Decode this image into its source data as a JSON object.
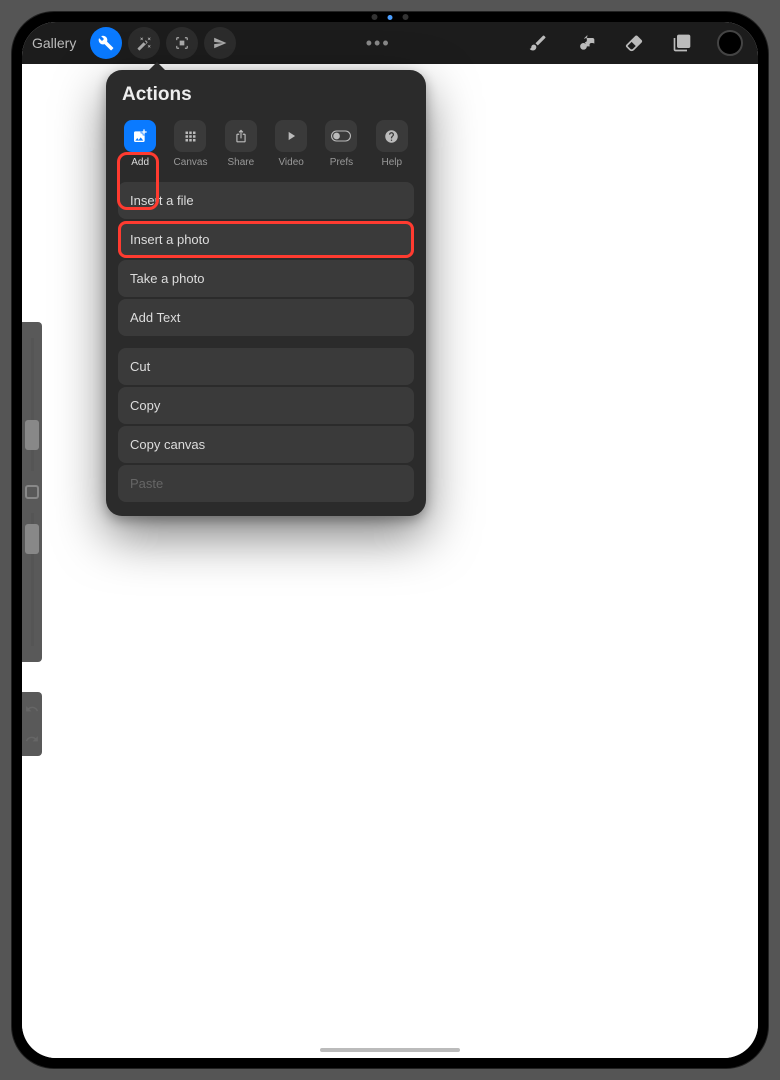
{
  "toolbar": {
    "gallery_label": "Gallery",
    "ellipsis": "•••"
  },
  "popover": {
    "title": "Actions",
    "tabs": [
      {
        "label": "Add"
      },
      {
        "label": "Canvas"
      },
      {
        "label": "Share"
      },
      {
        "label": "Video"
      },
      {
        "label": "Prefs"
      },
      {
        "label": "Help"
      }
    ],
    "menu": {
      "insert_file": "Insert a file",
      "insert_photo": "Insert a photo",
      "take_photo": "Take a photo",
      "add_text": "Add Text",
      "cut": "Cut",
      "copy": "Copy",
      "copy_canvas": "Copy canvas",
      "paste": "Paste"
    }
  }
}
